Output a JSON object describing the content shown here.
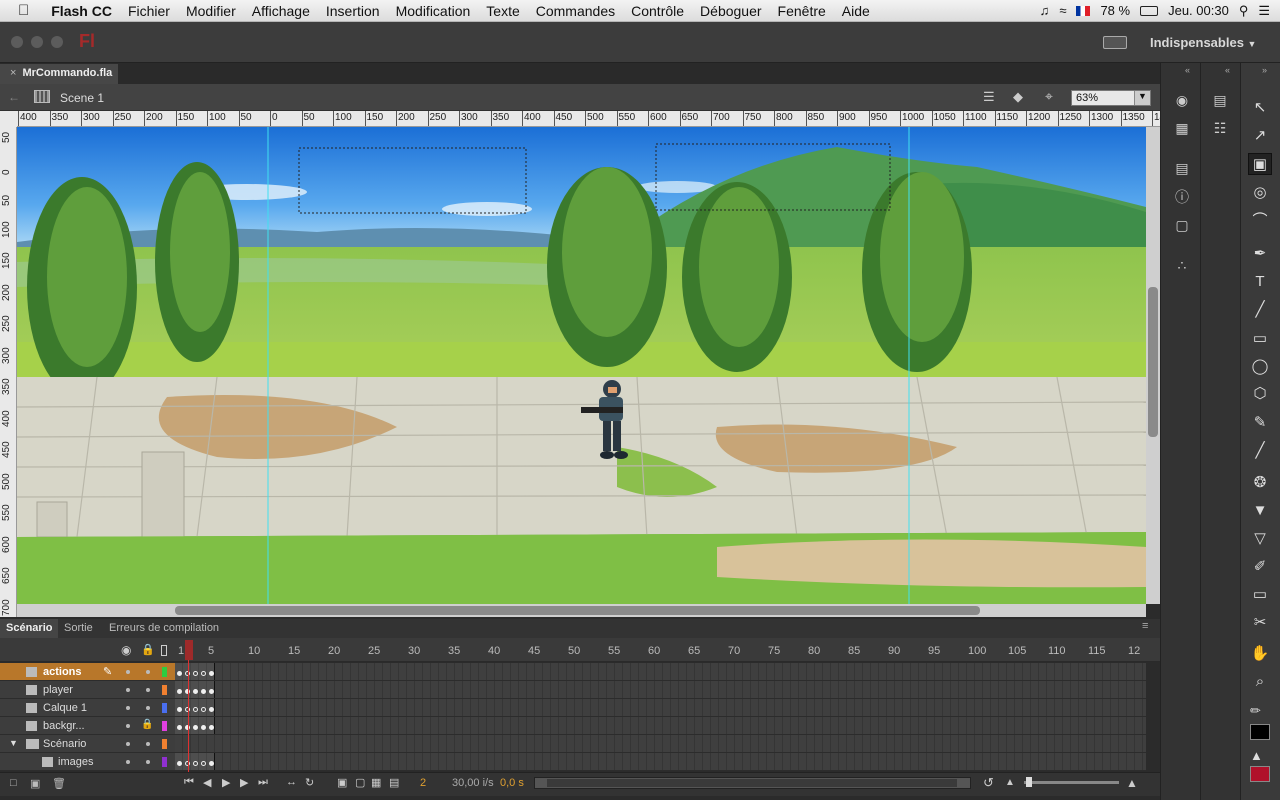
{
  "menubar": {
    "apple": "",
    "items": [
      "Flash CC",
      "Fichier",
      "Modifier",
      "Affichage",
      "Insertion",
      "Modification",
      "Texte",
      "Commandes",
      "Contrôle",
      "Déboguer",
      "Fenêtre",
      "Aide"
    ],
    "battery": "78 %",
    "clock": "Jeu. 00:30"
  },
  "app": {
    "logo": "Fl",
    "workspace": "Indispensables"
  },
  "document": {
    "tab": "MrCommando.fla",
    "scene": "Scene 1",
    "zoom": "63%"
  },
  "rulers": {
    "h": [
      "400",
      "350",
      "300",
      "250",
      "200",
      "150",
      "100",
      "50",
      "0",
      "50",
      "100",
      "150",
      "200",
      "250",
      "300",
      "350",
      "400",
      "450",
      "500",
      "550",
      "600",
      "650",
      "700",
      "750",
      "800",
      "850",
      "900",
      "950",
      "1000",
      "1050",
      "1100",
      "1150",
      "1200",
      "1250",
      "1300",
      "1350",
      "14"
    ],
    "v": [
      "50",
      "0",
      "50",
      "100",
      "150",
      "200",
      "250",
      "300",
      "350",
      "400",
      "450",
      "500",
      "550",
      "600",
      "650",
      "700",
      "50"
    ]
  },
  "timeline": {
    "tabs": [
      "Scénario",
      "Sortie",
      "Erreurs de compilation"
    ],
    "frame_numbers": [
      "1",
      "5",
      "10",
      "15",
      "20",
      "25",
      "30",
      "35",
      "40",
      "45",
      "50",
      "55",
      "60",
      "65",
      "70",
      "75",
      "80",
      "85",
      "90",
      "95",
      "100",
      "105",
      "110",
      "115",
      "12"
    ],
    "layers": [
      {
        "name": "actions",
        "color": "#2ecc40",
        "selected": true
      },
      {
        "name": "player",
        "color": "#f08030",
        "selected": false
      },
      {
        "name": "Calque 1",
        "color": "#4a6ff0",
        "selected": false
      },
      {
        "name": "backgr...",
        "color": "#e040e0",
        "selected": false
      },
      {
        "name": "Scénario",
        "color": "#f08030",
        "selected": false
      },
      {
        "name": "images",
        "color": "#9030d0",
        "selected": false
      }
    ],
    "current_frame": "2",
    "fps": "30,00 i/s",
    "time": "0,0 s"
  },
  "tools": [
    "selection-tool",
    "subselection-tool",
    "free-transform-tool",
    "3d-rotation-tool",
    "lasso-tool",
    "pen-tool",
    "text-tool",
    "line-tool",
    "rectangle-tool",
    "oval-tool",
    "polystar-tool",
    "pencil-tool",
    "brush-tool",
    "bone-tool",
    "paint-bucket-tool",
    "ink-bottle-tool",
    "eyedropper-tool",
    "eraser-tool",
    "width-tool",
    "hand-tool",
    "zoom-tool"
  ],
  "colors": {
    "stroke": "#000000",
    "fill": "#b0102a",
    "accent": "#e0a030"
  }
}
